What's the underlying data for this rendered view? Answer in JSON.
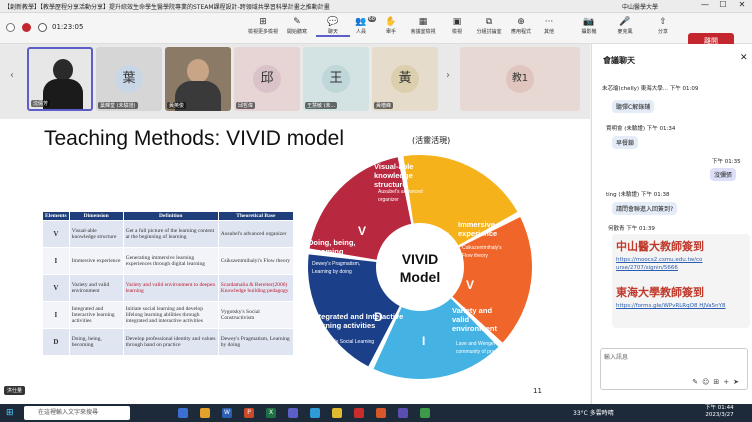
{
  "window": {
    "title": "【創新教學】【教學歷程分享活動分享】提升綜效生命學生醫學院專業的STEAM課程設計-跨領域共學習科學計畫之推動計畫",
    "org": "中山醫學大學",
    "min": "—",
    "max": "☐",
    "close": "✕"
  },
  "toolbar": {
    "timer": "01:23:05",
    "buttons": [
      {
        "label": "檢視更多檢視",
        "icon": "⊞"
      },
      {
        "label": "開始聽寫",
        "icon": "✎"
      },
      {
        "label": "聊天",
        "icon": "💬"
      },
      {
        "label": "人員",
        "icon": "👥",
        "badge": "68"
      },
      {
        "label": "舉手",
        "icon": "✋"
      },
      {
        "label": "會議室檢視",
        "icon": "▦"
      },
      {
        "label": "檢視",
        "icon": "▣"
      },
      {
        "label": "分組討論室",
        "icon": "⧉"
      },
      {
        "label": "應用程式",
        "icon": "⊕"
      },
      {
        "label": "其他",
        "icon": "···"
      },
      {
        "label": "攝影機",
        "icon": "📷"
      },
      {
        "label": "麥克風",
        "icon": "🎤"
      },
      {
        "label": "分享",
        "icon": "⇧"
      }
    ],
    "leave_label": "離開"
  },
  "participants": [
    {
      "name": "沈倩芳",
      "initial": ""
    },
    {
      "name": "葉輝堂 (未驗證)",
      "initial": "葉"
    },
    {
      "name": "黃英俊",
      "initial": ""
    },
    {
      "name": "邱哲偉",
      "initial": "邱"
    },
    {
      "name": "王慧敏 (未...",
      "initial": "王"
    },
    {
      "name": "黃楷峰",
      "initial": "黃"
    },
    {
      "name": "",
      "initial": "教1"
    }
  ],
  "presenter": "洪仕量",
  "slide": {
    "title": "Teaching Methods: VIVID model",
    "title_sub": "(活靈活現)",
    "page": "11",
    "table": {
      "headers": [
        "Elements",
        "Dimension",
        "Definition",
        "Theoretical Base"
      ],
      "rows": [
        [
          "V",
          "Visual-able knowledge structure",
          "Get a full picture of the learning content at the beginning of learning",
          "Ausubel's advanced organizer"
        ],
        [
          "I",
          "Immersive experience",
          "Generating immersive learning experiences through digital learning",
          "Csikszentmihalyi's Flow theory"
        ],
        [
          "V",
          "Variety and valid environment",
          "Variety and valid environment to deepen learning",
          "Scardamalia & Bereiter(2006) Knowledge building pedagogy"
        ],
        [
          "I",
          "Integrated and Interactive learning activities",
          "Initiate social learning and develop lifelong learning abilities through integrated and interactive activities",
          "Vygotsky's Social Constructivism"
        ],
        [
          "D",
          "Doing, being, becoming",
          "Develop professional identity and values through hand on practice",
          "Dewey's Pragmatism, Learning by doing"
        ]
      ]
    },
    "model": {
      "center_1": "VIVID",
      "center_2": "Model",
      "segments": [
        {
          "letter": "V",
          "title_1": "Visual-able",
          "title_2": "knowledge",
          "title_3": "structure",
          "sub_1": "Ausubel's advanced",
          "sub_2": "organizer",
          "color": "#f5b21b"
        },
        {
          "letter": "I",
          "title_1": "Immersive",
          "title_2": "experience",
          "title_3": "",
          "sub_1": "Csikszentmihaly's",
          "sub_2": "Flow theory",
          "color": "#f0662a"
        },
        {
          "letter": "V",
          "title_1": "Variety and",
          "title_2": "valid",
          "title_3": "environment",
          "sub_1": "Lave and Wenger's",
          "sub_2": "community of practice",
          "color": "#45b2e4"
        },
        {
          "letter": "I",
          "title_1": "Integrated and Interactive",
          "title_2": "learning activities",
          "title_3": "",
          "sub_1": "Bandura's Social Learning",
          "sub_2": "Theory",
          "color": "#1b3f88"
        },
        {
          "letter": "D",
          "title_1": "Doing, being,",
          "title_2": "becoming",
          "title_3": "",
          "sub_1": "Dewey's Pragmatism,",
          "sub_2": "Learning by doing",
          "color": "#b8283f"
        }
      ]
    }
  },
  "chat": {
    "title": "會議聊天",
    "messages": [
      {
        "text": "未芯瑜(chelly)    東海大學...  下午 01:09"
      },
      {
        "text": "聽彈C解錄鋪"
      },
      {
        "text": "賈明會 (未驗證)  下午 01:34"
      },
      {
        "text": "早餐鎖"
      },
      {
        "text": "下午 01:35"
      },
      {
        "text": "沒彌張"
      },
      {
        "text": "ting (未驗證)  下午 01:38"
      },
      {
        "text": "請問會聯進入回簽到?"
      },
      {
        "text": "何歡青  下午 01:39"
      }
    ],
    "card": {
      "heading_1": "中山醫大教師簽到",
      "link_1": "https://moocs2.csmu.edu.tw/co urse/2707/signin/5666",
      "heading_2": "東海大學教師簽到",
      "link_2": "https://forms.gle/WPvRLRqO8 HJVa5nY8"
    },
    "input_placeholder": "輸入訊息"
  },
  "taskbar": {
    "search": "在這裡輸入文字來搜尋",
    "weather": "33°C 多雲時晴",
    "time": "下午 01:44",
    "date": "2023/3/27"
  }
}
